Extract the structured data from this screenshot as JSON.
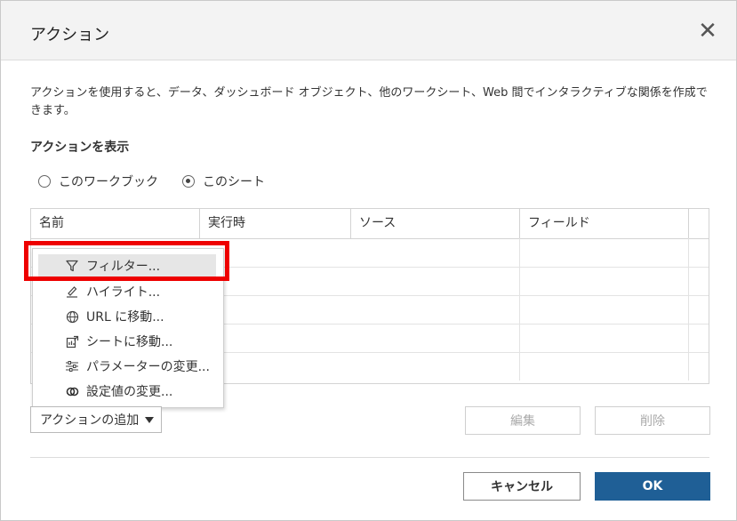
{
  "dialog": {
    "title": "アクション",
    "close_glyph": "✕",
    "description": "アクションを使用すると、データ、ダッシュボード オブジェクト、他のワークシート、Web 間でインタラクティブな関係を作成できます。",
    "show_actions_label": "アクションを表示",
    "radios": [
      {
        "label": "このワークブック",
        "checked": false
      },
      {
        "label": "このシート",
        "checked": true
      }
    ]
  },
  "grid": {
    "columns": [
      "名前",
      "実行時",
      "ソース",
      "フィールド"
    ]
  },
  "menu": {
    "items": [
      {
        "label": "フィルター...",
        "icon": "filter-icon",
        "selected": true
      },
      {
        "label": "ハイライト...",
        "icon": "highlight-pen-icon",
        "selected": false
      },
      {
        "label": "URL に移動...",
        "icon": "globe-icon",
        "selected": false
      },
      {
        "label": "シートに移動...",
        "icon": "sheet-jump-icon",
        "selected": false
      },
      {
        "label": "パラメーターの変更...",
        "icon": "sliders-icon",
        "selected": false
      },
      {
        "label": "設定値の変更...",
        "icon": "set-values-icon",
        "selected": false
      }
    ]
  },
  "buttons": {
    "add_action": "アクションの追加",
    "edit": "編集",
    "delete": "削除",
    "cancel": "キャンセル",
    "ok": "OK"
  },
  "colors": {
    "primary": "#1f5f96",
    "highlight_box": "#ee0000"
  }
}
